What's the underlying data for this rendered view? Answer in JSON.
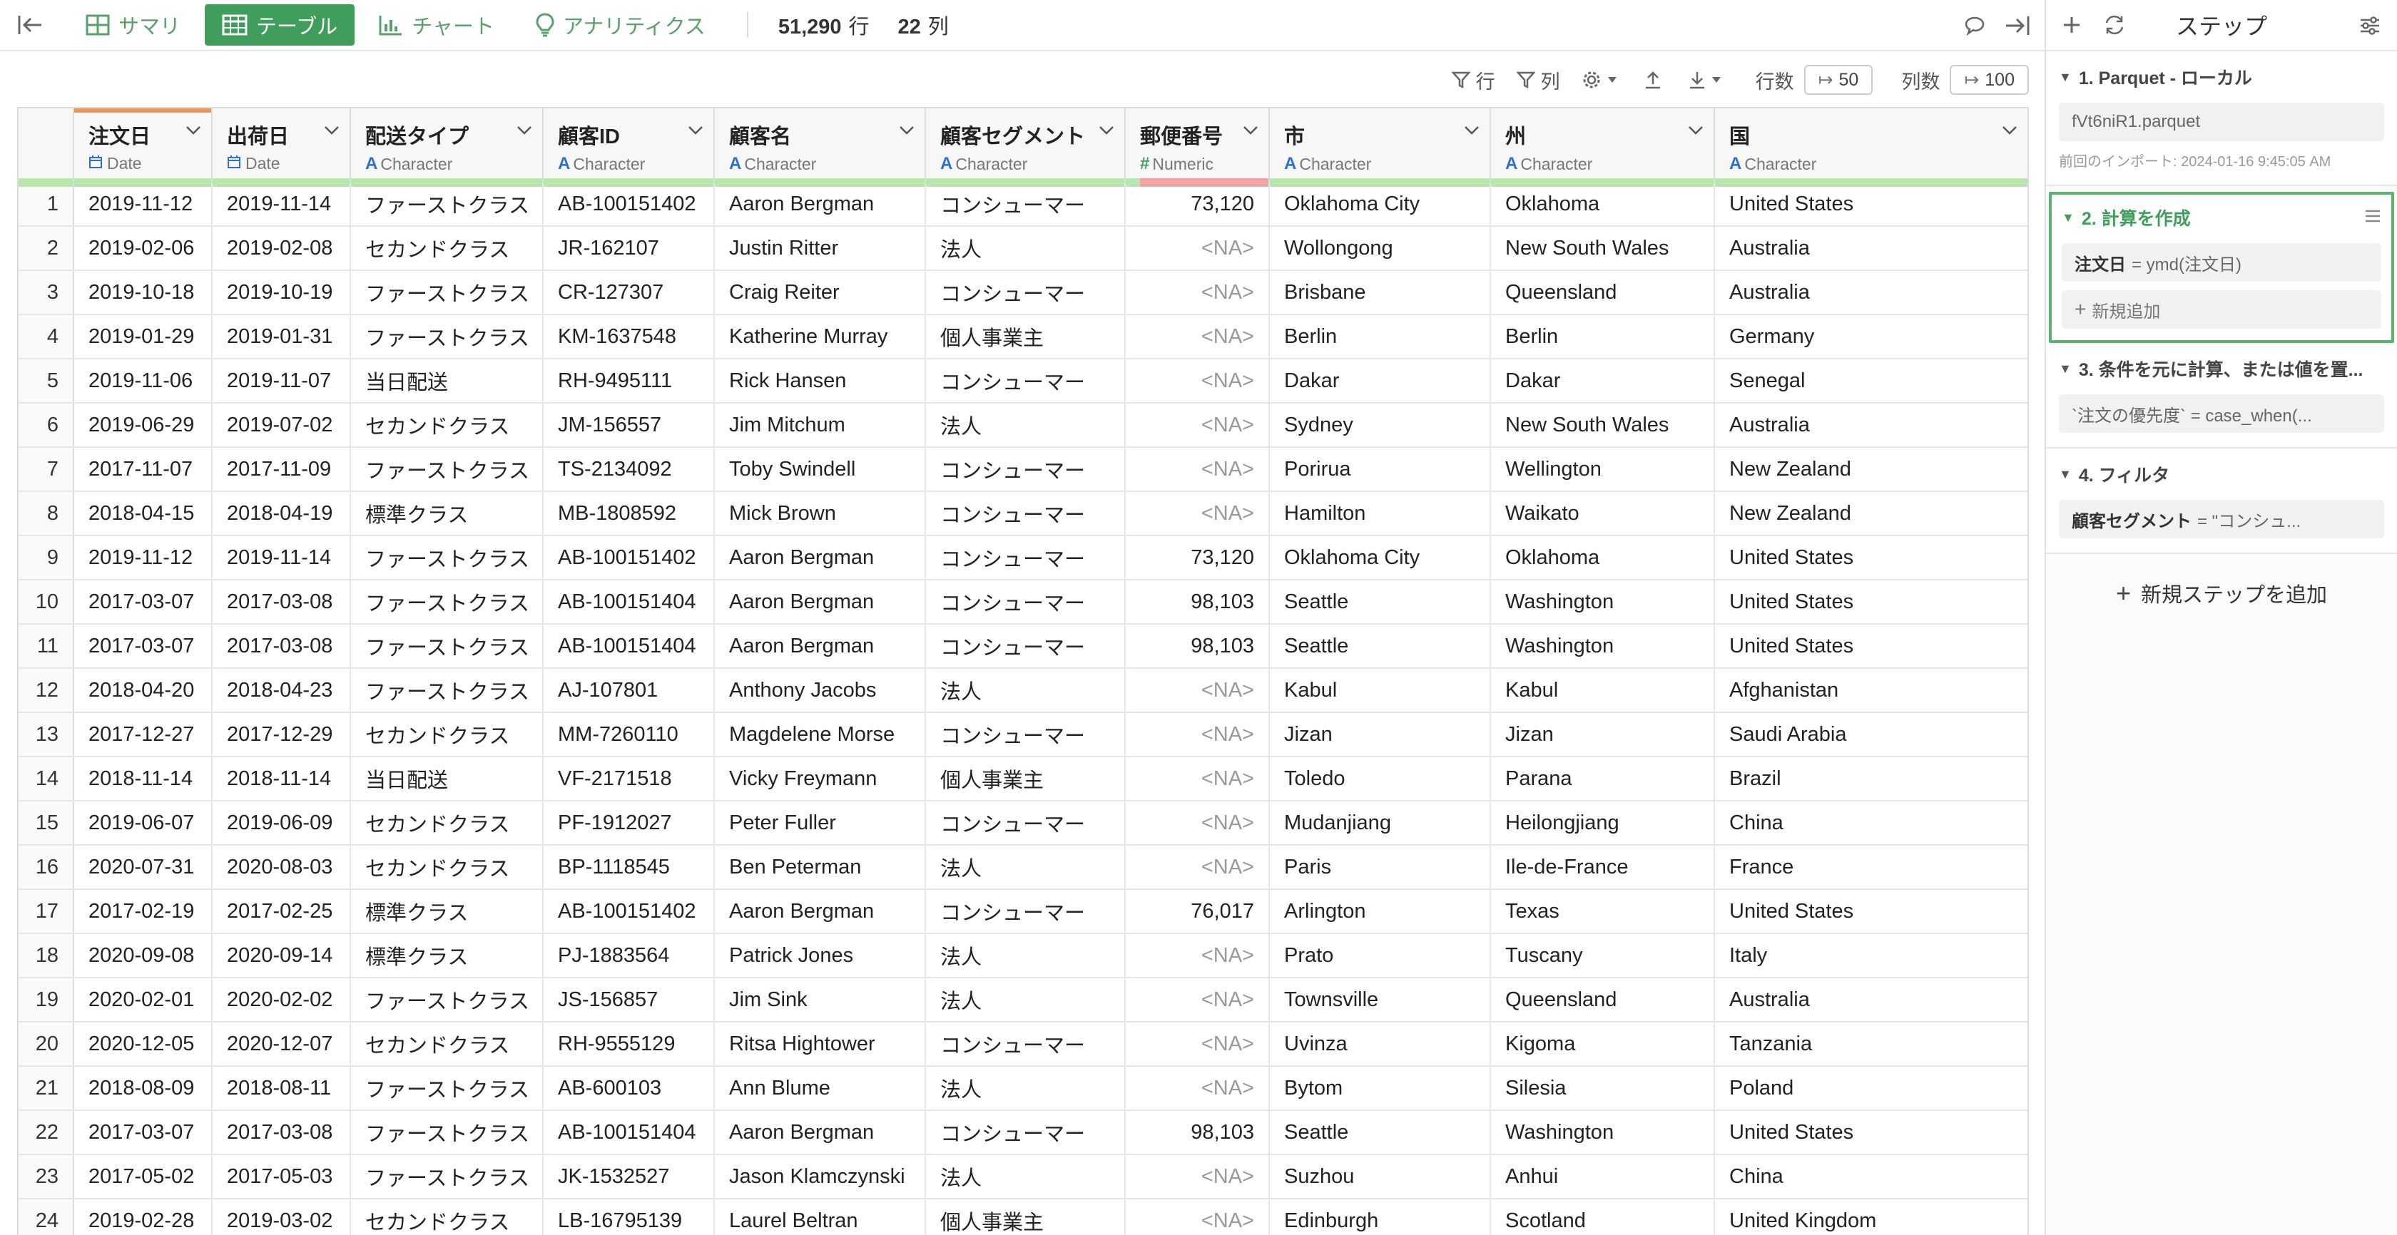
{
  "topbar": {
    "tabs": [
      {
        "label": "サマリ"
      },
      {
        "label": "テーブル"
      },
      {
        "label": "チャート"
      },
      {
        "label": "アナリティクス"
      }
    ],
    "row_count": "51,290",
    "row_unit": "行",
    "col_count": "22",
    "col_unit": "列"
  },
  "toolbar": {
    "row_filter": "行",
    "col_filter": "列",
    "rows_label": "行数",
    "rows_value": "50",
    "cols_label": "列数",
    "cols_value": "100"
  },
  "columns": [
    {
      "name": "注文日",
      "type": "Date",
      "type_kind": "date"
    },
    {
      "name": "出荷日",
      "type": "Date",
      "type_kind": "date"
    },
    {
      "name": "配送タイプ",
      "type": "Character",
      "type_kind": "char"
    },
    {
      "name": "顧客ID",
      "type": "Character",
      "type_kind": "char"
    },
    {
      "name": "顧客名",
      "type": "Character",
      "type_kind": "char"
    },
    {
      "name": "顧客セグメント",
      "type": "Character",
      "type_kind": "char"
    },
    {
      "name": "郵便番号",
      "type": "Numeric",
      "type_kind": "num"
    },
    {
      "name": "市",
      "type": "Character",
      "type_kind": "char"
    },
    {
      "name": "州",
      "type": "Character",
      "type_kind": "char"
    },
    {
      "name": "国",
      "type": "Character",
      "type_kind": "char"
    }
  ],
  "rows": [
    [
      "1",
      "2019-11-12",
      "2019-11-14",
      "ファーストクラス",
      "AB-100151402",
      "Aaron Bergman",
      "コンシューマー",
      "73,120",
      "Oklahoma City",
      "Oklahoma",
      "United States"
    ],
    [
      "2",
      "2019-02-06",
      "2019-02-08",
      "セカンドクラス",
      "JR-162107",
      "Justin Ritter",
      "法人",
      "<NA>",
      "Wollongong",
      "New South Wales",
      "Australia"
    ],
    [
      "3",
      "2019-10-18",
      "2019-10-19",
      "ファーストクラス",
      "CR-127307",
      "Craig Reiter",
      "コンシューマー",
      "<NA>",
      "Brisbane",
      "Queensland",
      "Australia"
    ],
    [
      "4",
      "2019-01-29",
      "2019-01-31",
      "ファーストクラス",
      "KM-1637548",
      "Katherine Murray",
      "個人事業主",
      "<NA>",
      "Berlin",
      "Berlin",
      "Germany"
    ],
    [
      "5",
      "2019-11-06",
      "2019-11-07",
      "当日配送",
      "RH-9495111",
      "Rick Hansen",
      "コンシューマー",
      "<NA>",
      "Dakar",
      "Dakar",
      "Senegal"
    ],
    [
      "6",
      "2019-06-29",
      "2019-07-02",
      "セカンドクラス",
      "JM-156557",
      "Jim Mitchum",
      "法人",
      "<NA>",
      "Sydney",
      "New South Wales",
      "Australia"
    ],
    [
      "7",
      "2017-11-07",
      "2017-11-09",
      "ファーストクラス",
      "TS-2134092",
      "Toby Swindell",
      "コンシューマー",
      "<NA>",
      "Porirua",
      "Wellington",
      "New Zealand"
    ],
    [
      "8",
      "2018-04-15",
      "2018-04-19",
      "標準クラス",
      "MB-1808592",
      "Mick Brown",
      "コンシューマー",
      "<NA>",
      "Hamilton",
      "Waikato",
      "New Zealand"
    ],
    [
      "9",
      "2019-11-12",
      "2019-11-14",
      "ファーストクラス",
      "AB-100151402",
      "Aaron Bergman",
      "コンシューマー",
      "73,120",
      "Oklahoma City",
      "Oklahoma",
      "United States"
    ],
    [
      "10",
      "2017-03-07",
      "2017-03-08",
      "ファーストクラス",
      "AB-100151404",
      "Aaron Bergman",
      "コンシューマー",
      "98,103",
      "Seattle",
      "Washington",
      "United States"
    ],
    [
      "11",
      "2017-03-07",
      "2017-03-08",
      "ファーストクラス",
      "AB-100151404",
      "Aaron Bergman",
      "コンシューマー",
      "98,103",
      "Seattle",
      "Washington",
      "United States"
    ],
    [
      "12",
      "2018-04-20",
      "2018-04-23",
      "ファーストクラス",
      "AJ-107801",
      "Anthony Jacobs",
      "法人",
      "<NA>",
      "Kabul",
      "Kabul",
      "Afghanistan"
    ],
    [
      "13",
      "2017-12-27",
      "2017-12-29",
      "セカンドクラス",
      "MM-7260110",
      "Magdelene Morse",
      "コンシューマー",
      "<NA>",
      "Jizan",
      "Jizan",
      "Saudi Arabia"
    ],
    [
      "14",
      "2018-11-14",
      "2018-11-14",
      "当日配送",
      "VF-2171518",
      "Vicky Freymann",
      "個人事業主",
      "<NA>",
      "Toledo",
      "Parana",
      "Brazil"
    ],
    [
      "15",
      "2019-06-07",
      "2019-06-09",
      "セカンドクラス",
      "PF-1912027",
      "Peter Fuller",
      "コンシューマー",
      "<NA>",
      "Mudanjiang",
      "Heilongjiang",
      "China"
    ],
    [
      "16",
      "2020-07-31",
      "2020-08-03",
      "セカンドクラス",
      "BP-1118545",
      "Ben Peterman",
      "法人",
      "<NA>",
      "Paris",
      "Ile-de-France",
      "France"
    ],
    [
      "17",
      "2017-02-19",
      "2017-02-25",
      "標準クラス",
      "AB-100151402",
      "Aaron Bergman",
      "コンシューマー",
      "76,017",
      "Arlington",
      "Texas",
      "United States"
    ],
    [
      "18",
      "2020-09-08",
      "2020-09-14",
      "標準クラス",
      "PJ-1883564",
      "Patrick Jones",
      "法人",
      "<NA>",
      "Prato",
      "Tuscany",
      "Italy"
    ],
    [
      "19",
      "2020-02-01",
      "2020-02-02",
      "ファーストクラス",
      "JS-156857",
      "Jim Sink",
      "法人",
      "<NA>",
      "Townsville",
      "Queensland",
      "Australia"
    ],
    [
      "20",
      "2020-12-05",
      "2020-12-07",
      "セカンドクラス",
      "RH-9555129",
      "Ritsa Hightower",
      "コンシューマー",
      "<NA>",
      "Uvinza",
      "Kigoma",
      "Tanzania"
    ],
    [
      "21",
      "2018-08-09",
      "2018-08-11",
      "ファーストクラス",
      "AB-600103",
      "Ann Blume",
      "法人",
      "<NA>",
      "Bytom",
      "Silesia",
      "Poland"
    ],
    [
      "22",
      "2017-03-07",
      "2017-03-08",
      "ファーストクラス",
      "AB-100151404",
      "Aaron Bergman",
      "コンシューマー",
      "98,103",
      "Seattle",
      "Washington",
      "United States"
    ],
    [
      "23",
      "2017-05-02",
      "2017-05-03",
      "ファーストクラス",
      "JK-1532527",
      "Jason Klamczynski",
      "法人",
      "<NA>",
      "Suzhou",
      "Anhui",
      "China"
    ],
    [
      "24",
      "2019-02-28",
      "2019-03-02",
      "セカンドクラス",
      "LB-16795139",
      "Laurel Beltran",
      "個人事業主",
      "<NA>",
      "Edinburgh",
      "Scotland",
      "United Kingdom"
    ]
  ],
  "panel": {
    "title": "ステップ",
    "steps": [
      {
        "title": "1. Parquet - ローカル",
        "box_text": "fVt6niR1.parquet",
        "note": "前回のインポート: 2024-01-16 9:45:05 AM"
      },
      {
        "title": "2. 計算を作成",
        "box_bold": "注文日",
        "box_text": "= ymd(注文日)",
        "add_label": "新規追加"
      },
      {
        "title": "3. 条件を元に計算、または値を置...",
        "box_text": "`注文の優先度` = case_when(..."
      },
      {
        "title": "4. フィルタ",
        "box_bold": "顧客セグメント",
        "box_text": "= \"コンシュ..."
      }
    ],
    "add_step_label": "新規ステップを追加"
  },
  "colors": {
    "accent_green": "#3f9e5b",
    "active_step_border": "#5bb46e",
    "type_char_blue": "#2f6fd0",
    "header_accent_orange": "#e8965a",
    "quality_ok": "#b8e8b0",
    "quality_bad": "#f1a6a6"
  }
}
